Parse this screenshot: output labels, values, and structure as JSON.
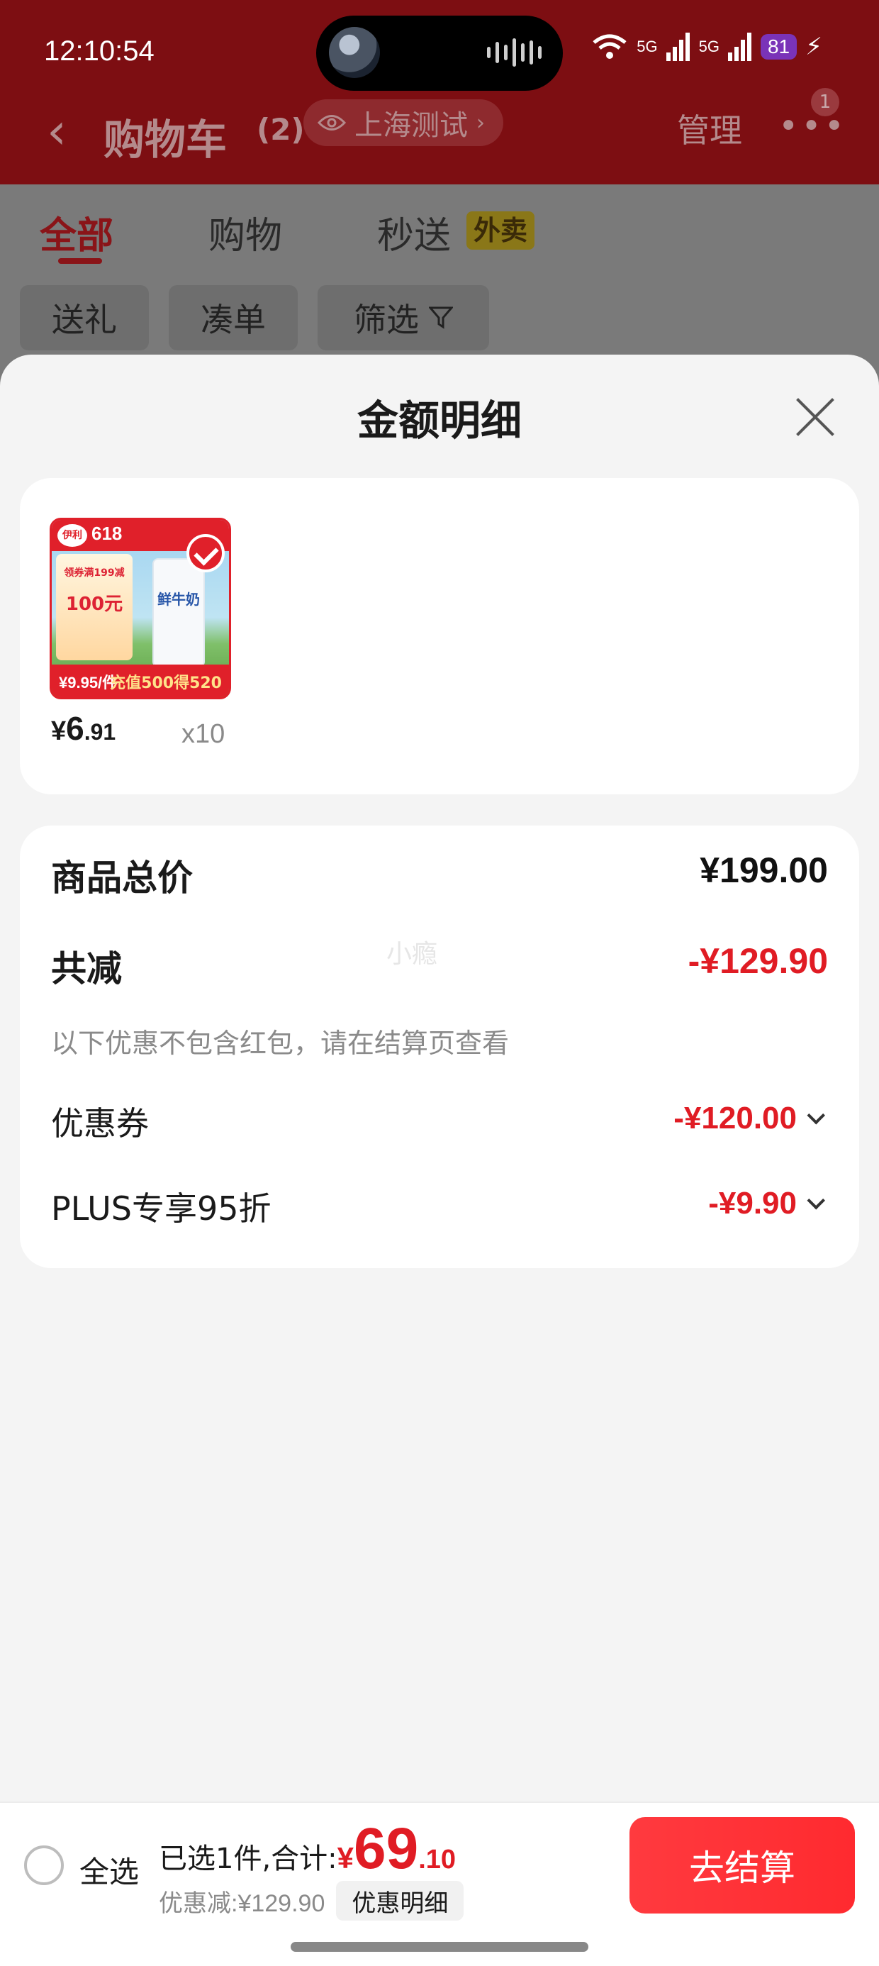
{
  "status_bar": {
    "time": "12:10:54",
    "signal_1": "5G",
    "signal_2": "5G",
    "battery": "81"
  },
  "nav": {
    "back_icon": "chevron-left-icon",
    "title": "购物车",
    "count": "(2)",
    "location": "上海测试",
    "manage": "管理",
    "more_badge": "1"
  },
  "tabs": [
    {
      "label": "全部",
      "active": true
    },
    {
      "label": "购物",
      "active": false
    },
    {
      "label": "秒送",
      "active": false,
      "tag": "外卖"
    }
  ],
  "chips": [
    {
      "label": "送礼"
    },
    {
      "label": "凑单"
    },
    {
      "label": "筛选"
    }
  ],
  "sheet": {
    "title": "金额明细",
    "product": {
      "image_text": {
        "badge": "618",
        "promo_title": "领券满199减",
        "promo_amount": "100元",
        "carton_name": "鲜牛奶",
        "price_tag": "¥9.95/件",
        "promo_bottom": "充值500得520"
      },
      "price_currency": "¥",
      "price_int": "6",
      "price_dec": ".91",
      "quantity": "x10"
    },
    "summary": {
      "total_label": "商品总价",
      "total_value": "¥199.00",
      "reduce_label": "共减",
      "reduce_value": "-¥129.90",
      "reduce_note": "以下优惠不包含红包，请在结算页查看",
      "items": [
        {
          "label": "优惠券",
          "value": "-¥120.00"
        },
        {
          "label": "PLUS专享95折",
          "value": "-¥9.90"
        }
      ]
    },
    "watermark": "小瘾"
  },
  "bottom_bar": {
    "select_all": "全选",
    "total_prefix": "已选1件,合计:",
    "total_currency": "¥",
    "total_int": "69",
    "total_dec": ".10",
    "discount": "优惠减:¥129.90",
    "detail_button": "优惠明细",
    "checkout": "去结算"
  },
  "colors": {
    "accent_red": "#e01c24",
    "header_red": "#c8141b",
    "checkout_red": "#ff3a3f"
  }
}
